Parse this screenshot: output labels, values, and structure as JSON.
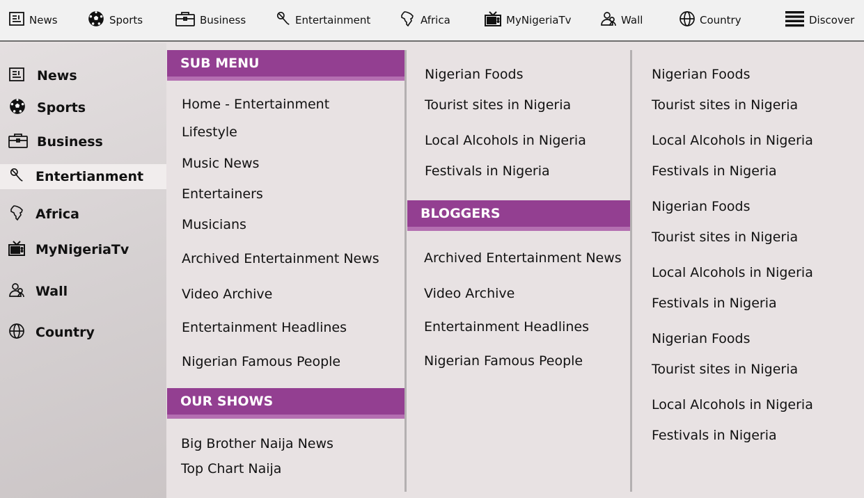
{
  "topnav": [
    {
      "label": "News",
      "icon": "newspaper-icon"
    },
    {
      "label": "Sports",
      "icon": "soccer-ball-icon"
    },
    {
      "label": "Business",
      "icon": "briefcase-icon"
    },
    {
      "label": "Entertainment",
      "icon": "microphone-icon"
    },
    {
      "label": "Africa",
      "icon": "africa-map-icon"
    },
    {
      "label": "MyNigeriaTv",
      "icon": "tv-icon"
    },
    {
      "label": "Wall",
      "icon": "people-icon"
    },
    {
      "label": "Country",
      "icon": "globe-icon"
    },
    {
      "label": "Discover",
      "icon": "menu-icon"
    }
  ],
  "sidebar": [
    {
      "label": "News",
      "icon": "newspaper-icon",
      "active": false
    },
    {
      "label": "Sports",
      "icon": "soccer-ball-icon",
      "active": false
    },
    {
      "label": "Business",
      "icon": "briefcase-icon",
      "active": false
    },
    {
      "label": "Entertianment",
      "icon": "microphone-icon",
      "active": true
    },
    {
      "label": "Africa",
      "icon": "africa-map-icon",
      "active": false
    },
    {
      "label": "MyNigeriaTv",
      "icon": "tv-icon",
      "active": false
    },
    {
      "label": "Wall",
      "icon": "people-icon",
      "active": false
    },
    {
      "label": "Country",
      "icon": "globe-icon",
      "active": false
    }
  ],
  "col1": {
    "submenu_header": "SUB MENU",
    "submenu_links": [
      "Home - Entertainment",
      "Lifestyle",
      "Music News",
      "Entertainers",
      "Musicians",
      "Archived Entertainment News",
      "Video Archive",
      "Entertainment Headlines",
      "Nigerian Famous People"
    ],
    "shows_header": "OUR SHOWS",
    "shows_links": [
      "Big Brother Naija News",
      "Top Chart Naija"
    ]
  },
  "col2": {
    "top_links": [
      "Nigerian Foods",
      "Tourist sites in Nigeria",
      "Local Alcohols in Nigeria",
      "Festivals in Nigeria"
    ],
    "bloggers_header": "BLOGGERS",
    "bloggers_links": [
      "Archived Entertainment News",
      "Video Archive",
      "Entertainment Headlines",
      "Nigerian Famous People"
    ]
  },
  "col3": {
    "links": [
      "Nigerian Foods",
      "Tourist sites in Nigeria",
      "Local Alcohols in Nigeria",
      "Festivals in Nigeria",
      "Nigerian Foods",
      "Tourist sites in Nigeria",
      "Local Alcohols in Nigeria",
      "Festivals in Nigeria",
      "Nigerian Foods",
      "Tourist sites in Nigeria",
      "Local Alcohols in Nigeria",
      "Festivals in Nigeria"
    ]
  },
  "colors": {
    "accent": "#933f91",
    "accent_light": "#b46fb1",
    "panel_bg": "#e8e2e3",
    "topnav_bg": "#f1f1f1"
  }
}
